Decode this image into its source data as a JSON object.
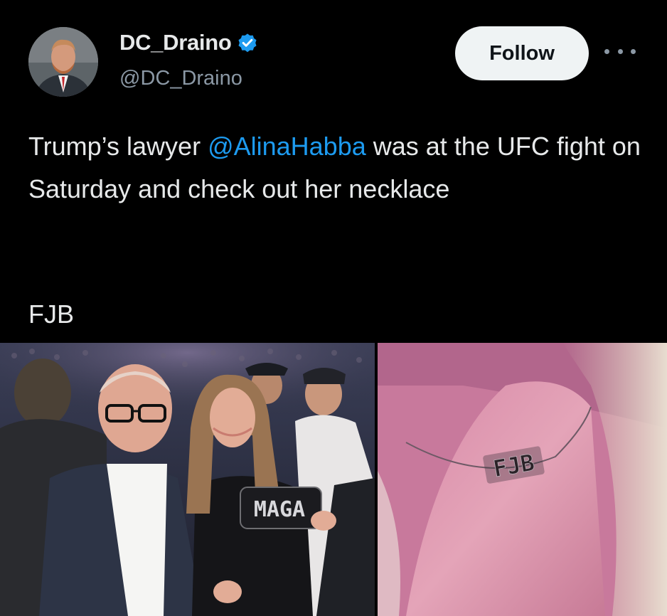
{
  "author": {
    "display_name": "DC_Draino",
    "handle": "@DC_Draino",
    "verified_icon": "verified-badge-icon",
    "avatar_icon": "avatar-photo"
  },
  "actions": {
    "follow_label": "Follow",
    "more_icon": "more-options-icon"
  },
  "tweet": {
    "text_before": "Trump’s lawyer ",
    "mention": "@AlinaHabba",
    "text_after": " was at the UFC fight on Saturday and check out her necklace",
    "sign_off": "FJB"
  },
  "media": {
    "left_clutch_text": "MAGA",
    "right_necklace_text": "FJB"
  },
  "colors": {
    "background": "#000000",
    "text": "#e7e9ea",
    "secondary_text": "#8b98a5",
    "link": "#1d9bf0",
    "verified": "#1d9bf0",
    "follow_bg": "#eff3f4"
  }
}
